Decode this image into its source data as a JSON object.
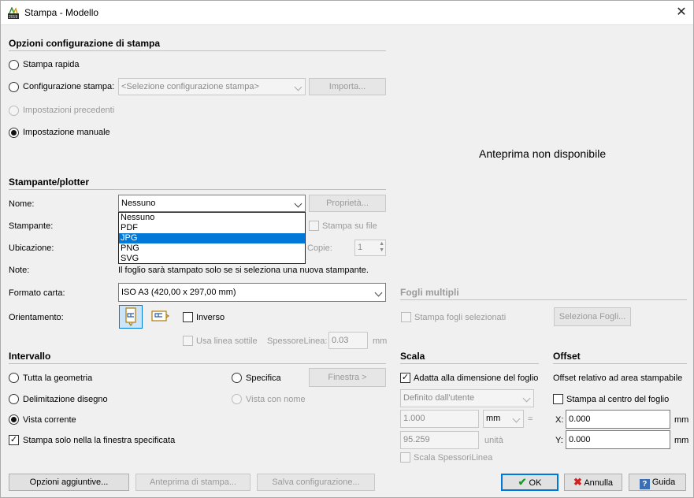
{
  "window": {
    "title": "Stampa - Modello",
    "app_icon": "autocad-2019-icon",
    "close_icon": "close-icon"
  },
  "opzioni": {
    "header": "Opzioni configurazione di stampa",
    "stampa_rapida": "Stampa rapida",
    "configurazione": "Configurazione stampa:",
    "config_placeholder": "<Selezione configurazione stampa>",
    "importa": "Importa...",
    "precedenti": "Impostazioni precedenti",
    "manuale": "Impostazione manuale"
  },
  "preview": {
    "text": "Anteprima non disponibile"
  },
  "plotter": {
    "header": "Stampante/plotter",
    "nome_label": "Nome:",
    "nome_value": "Nessuno",
    "proprieta": "Proprietà...",
    "options": [
      "Nessuno",
      "PDF",
      "JPG",
      "PNG",
      "SVG"
    ],
    "selected_option": "JPG",
    "stampante_label": "Stampante:",
    "stampa_su_file": "Stampa su file",
    "ubicazione_label": "Ubicazione:",
    "copie_label": "Copie:",
    "copie_value": "1",
    "note_label": "Note:",
    "note_value": "Il foglio sarà stampato solo se si seleziona una nuova stampante."
  },
  "carta": {
    "formato_label": "Formato carta:",
    "formato_value": "ISO A3 (420,00 x 297,00 mm)",
    "orientamento_label": "Orientamento:",
    "inverso": "Inverso",
    "linea_sottile": "Usa linea sottile",
    "spessore_label": "SpessoreLinea:",
    "spessore_value": "0.03",
    "spessore_unit": "mm"
  },
  "fogli": {
    "header": "Fogli multipli",
    "stampa_selezionati": "Stampa fogli selezionati",
    "seleziona": "Seleziona Fogli..."
  },
  "intervallo": {
    "header": "Intervallo",
    "tutta": "Tutta la geometria",
    "delimitazione": "Delimitazione disegno",
    "vista_corrente": "Vista corrente",
    "specifica": "Specifica",
    "finestra": "Finestra >",
    "vista_nome": "Vista con nome",
    "solo_finestra": "Stampa solo nella la finestra specificata"
  },
  "scala": {
    "header": "Scala",
    "adatta": "Adatta alla dimensione del foglio",
    "definito": "Definito dall'utente",
    "val1": "1.000",
    "unit_mm": "mm",
    "equals": "=",
    "val2": "95.259",
    "unita": "unità",
    "spessori": "Scala SpessoriLinea"
  },
  "offset": {
    "header": "Offset",
    "relativo": "Offset relativo ad area stampabile",
    "centro": "Stampa al centro del foglio",
    "x_label": "X:",
    "x_value": "0.000",
    "y_label": "Y:",
    "y_value": "0.000",
    "unit": "mm"
  },
  "footer": {
    "opzioni_aggiuntive": "Opzioni aggiuntive...",
    "anteprima": "Anteprima di stampa...",
    "salva": "Salva configurazione...",
    "ok": "OK",
    "annulla": "Annulla",
    "guida": "Guida"
  },
  "colors": {
    "accent": "#0078d7",
    "ok_check": "#1a9a2a",
    "cancel_x": "#d21f1f"
  }
}
